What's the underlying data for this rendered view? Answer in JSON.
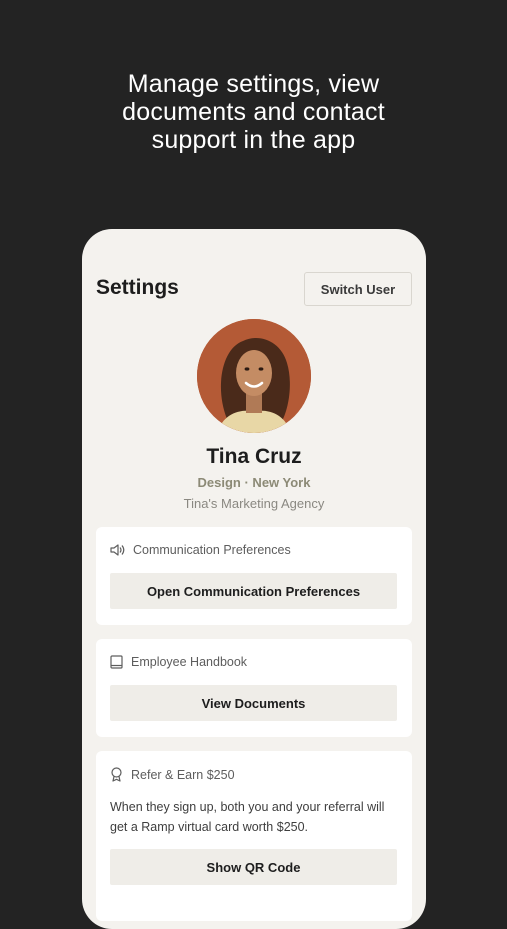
{
  "headline": {
    "line1": "Manage settings, view",
    "line2": "documents and contact",
    "line3": "support in the app"
  },
  "settings": {
    "title": "Settings",
    "switch_user_label": "Switch User"
  },
  "profile": {
    "name": "Tina Cruz",
    "meta": "Design · New York",
    "company": "Tina's Marketing Agency"
  },
  "cards": {
    "communication": {
      "icon": "speaker-icon",
      "title": "Communication Preferences",
      "button": "Open Communication Preferences"
    },
    "handbook": {
      "icon": "book-icon",
      "title": "Employee Handbook",
      "button": "View Documents"
    },
    "refer": {
      "icon": "award-icon",
      "title": "Refer & Earn $250",
      "body": "When they sign up, both you and your referral will get a Ramp virtual card worth $250.",
      "button": "Show QR Code"
    }
  },
  "colors": {
    "background": "#232323",
    "phone": "#f4f2ee",
    "avatar_bg": "#b45a36",
    "meta_text": "#8c8a76"
  }
}
